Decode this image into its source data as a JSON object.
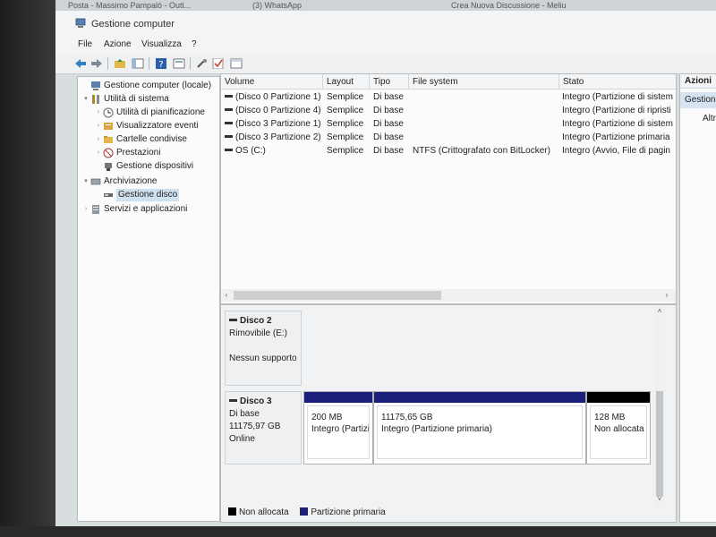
{
  "browser_tabs": [
    "Posta - Massimo Pampaló - Outl...",
    "(3) WhatsApp",
    "Crea Nuova Discussione - Meliu"
  ],
  "window": {
    "title": "Gestione computer"
  },
  "menu": [
    "File",
    "Azione",
    "Visualizza",
    "?"
  ],
  "toolbar_icons": [
    "back-icon",
    "forward-icon",
    "up-folder-icon",
    "show-hide-tree-icon",
    "help-icon",
    "properties-icon",
    "connect-icon",
    "checkmark-icon",
    "console-icon"
  ],
  "tree": [
    {
      "label": "Gestione computer (locale)",
      "icon": "computer-icon",
      "level": 0,
      "expander": ""
    },
    {
      "label": "Utilità di sistema",
      "icon": "tools-icon",
      "level": 1,
      "expander": "▾"
    },
    {
      "label": "Utilità di pianificazione",
      "icon": "clock-icon",
      "level": 2,
      "expander": "›"
    },
    {
      "label": "Visualizzatore eventi",
      "icon": "event-viewer-icon",
      "level": 2,
      "expander": "›"
    },
    {
      "label": "Cartelle condivise",
      "icon": "shared-folder-icon",
      "level": 2,
      "expander": "›"
    },
    {
      "label": "Prestazioni",
      "icon": "performance-icon",
      "level": 2,
      "expander": "›"
    },
    {
      "label": "Gestione dispositivi",
      "icon": "device-manager-icon",
      "level": 2,
      "expander": ""
    },
    {
      "label": "Archiviazione",
      "icon": "storage-icon",
      "level": 1,
      "expander": "▾"
    },
    {
      "label": "Gestione disco",
      "icon": "disk-icon",
      "level": 2,
      "expander": "",
      "selected": true
    },
    {
      "label": "Servizi e applicazioni",
      "icon": "services-icon",
      "level": 1,
      "expander": "›"
    }
  ],
  "volume_columns": [
    "Volume",
    "Layout",
    "Tipo",
    "File system",
    "Stato"
  ],
  "volumes": [
    {
      "volume": "(Disco 0 Partizione 1)",
      "layout": "Semplice",
      "tipo": "Di base",
      "fs": "",
      "stato": "Integro (Partizione di sistem"
    },
    {
      "volume": "(Disco 0 Partizione 4)",
      "layout": "Semplice",
      "tipo": "Di base",
      "fs": "",
      "stato": "Integro (Partizione di ripristi"
    },
    {
      "volume": "(Disco 3 Partizione 1)",
      "layout": "Semplice",
      "tipo": "Di base",
      "fs": "",
      "stato": "Integro (Partizione di sistem"
    },
    {
      "volume": "(Disco 3 Partizione 2)",
      "layout": "Semplice",
      "tipo": "Di base",
      "fs": "",
      "stato": "Integro (Partizione primaria"
    },
    {
      "volume": "OS (C:)",
      "layout": "Semplice",
      "tipo": "Di base",
      "fs": "NTFS (Crittografato con BitLocker)",
      "stato": "Integro (Avvio, File di pagin"
    }
  ],
  "disks": [
    {
      "name": "Disco 2",
      "lines": [
        "Rimovibile (E:)",
        "",
        "Nessun supporto"
      ],
      "partitions": []
    },
    {
      "name": "Disco 3",
      "lines": [
        "Di base",
        "11175,97 GB",
        "Online"
      ],
      "partitions": [
        {
          "size": "200 MB",
          "status": "Integro (Partizi",
          "kind": "primary"
        },
        {
          "size": "11175,65 GB",
          "status": "Integro (Partizione primaria)",
          "kind": "primary"
        },
        {
          "size": "128 MB",
          "status": "Non allocata",
          "kind": "unallocated"
        }
      ]
    }
  ],
  "legend": [
    {
      "label": "Non allocata",
      "color": "#000000"
    },
    {
      "label": "Partizione primaria",
      "color": "#1b1f7a"
    }
  ],
  "actions": {
    "title": "Azioni",
    "selected": "Gestione disco",
    "other": "Altre azioni"
  },
  "colors": {
    "primary": "#1b1f7a",
    "unallocated": "#000000",
    "selection": "#cfe0ef"
  }
}
